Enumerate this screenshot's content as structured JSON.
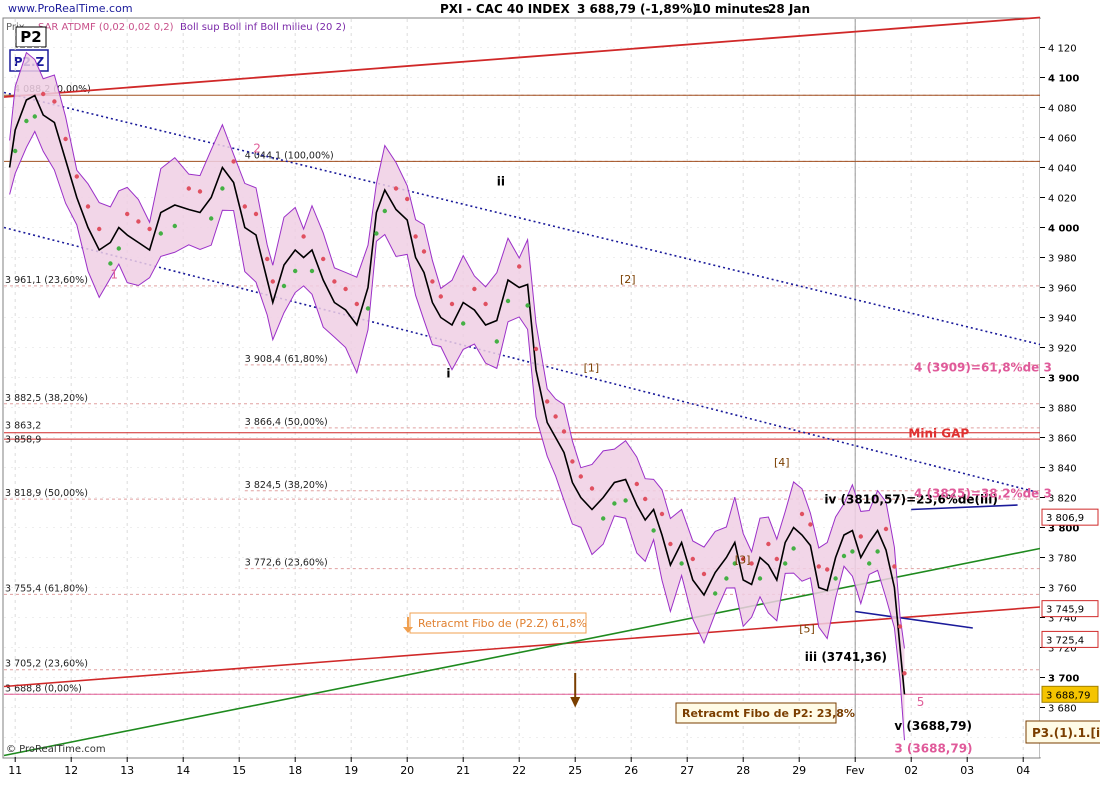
{
  "header": {
    "site": "www.ProRealTime.com",
    "title": "PXI - CAC 40 INDEX",
    "price": "3 688,79 (-1,89%)",
    "period": "10 minutes",
    "date": "28 Jan"
  },
  "indicators": {
    "price_label": "Prix",
    "sar": "SAR ATDMF (0,02 0,02 0,2)",
    "boll": "Boll sup Boll inf Boll milieu (20 2)"
  },
  "badges": {
    "p2": "P2",
    "p2z": "P2.Z"
  },
  "footer": "© ProRealTime.com",
  "colors": {
    "price": "#000000",
    "bollinger_fill": "#f0cfe4",
    "bollinger_line": "#9b30c8",
    "sar_green": "#44b044",
    "sar_red": "#e05060",
    "channel": "#1a1a9a",
    "trend_red": "#d02828",
    "trend_green": "#1e8a1e",
    "fib_line": "#e0a0a0",
    "target_pink": "#e05a9a",
    "brown": "#7a3e00"
  },
  "chart_data": {
    "type": "line",
    "title": "PXI - CAC 40 INDEX",
    "period": "10 minutes",
    "y_ticks": [
      3660,
      3680,
      3700,
      3720,
      3740,
      3760,
      3780,
      3800,
      3820,
      3840,
      3860,
      3880,
      3900,
      3920,
      3940,
      3960,
      3980,
      4000,
      4020,
      4040,
      4060,
      4080,
      4100,
      4120
    ],
    "y_tick_labels": [
      "3 660",
      "3 680",
      "3 700",
      "3 720",
      "3 740",
      "3 760",
      "3 780",
      "3 800",
      "3 820",
      "3 840",
      "3 860",
      "3 880",
      "3 900",
      "3 920",
      "3 940",
      "3 960",
      "3 980",
      "4 000",
      "4 020",
      "4 040",
      "4 060",
      "4 080",
      "4 100",
      "4 120"
    ],
    "ylim": [
      3647,
      4139
    ],
    "x_labels": [
      "11",
      "12",
      "13",
      "14",
      "15",
      "18",
      "19",
      "20",
      "21",
      "22",
      "25",
      "26",
      "27",
      "28",
      "29",
      "Fev",
      "02",
      "03",
      "04"
    ],
    "x_ticks": [
      11,
      12,
      13,
      14,
      15,
      16,
      17,
      18,
      19,
      20,
      21,
      22,
      23,
      24,
      25,
      26,
      27,
      28,
      29
    ],
    "xlim": [
      10.8,
      29.3
    ],
    "series": [
      {
        "x": [
          10.9,
          11.0,
          11.2,
          11.35,
          11.5,
          11.7,
          11.9,
          12.1,
          12.3,
          12.5,
          12.7,
          12.85,
          13.0,
          13.2,
          13.4,
          13.6,
          13.85,
          14.1,
          14.3,
          14.5,
          14.7,
          14.9,
          15.1,
          15.3,
          15.5,
          15.6,
          15.8,
          16.0,
          16.15,
          16.3,
          16.5,
          16.7,
          16.9,
          17.1,
          17.3,
          17.45,
          17.6,
          17.8,
          18.0,
          18.15,
          18.3,
          18.45,
          18.6,
          18.8,
          19.0,
          19.2,
          19.4,
          19.6,
          19.8,
          20.0,
          20.15,
          20.3,
          20.5,
          20.65,
          20.8,
          20.95,
          21.1,
          21.3,
          21.5,
          21.7,
          21.9,
          22.1,
          22.25,
          22.4,
          22.55,
          22.7,
          22.9,
          23.1,
          23.3,
          23.5,
          23.7,
          23.85,
          24.0,
          24.15,
          24.3,
          24.45,
          24.6,
          24.75,
          24.9,
          25.05,
          25.2,
          25.35,
          25.5,
          25.65,
          25.8,
          25.95,
          26.1,
          26.25,
          26.4,
          26.55,
          26.7,
          26.8,
          26.88
        ],
        "values": [
          4040,
          4065,
          4085,
          4088,
          4075,
          4070,
          4045,
          4020,
          4000,
          3985,
          3990,
          4000,
          3995,
          3990,
          3985,
          4010,
          4015,
          4012,
          4010,
          4020,
          4040,
          4030,
          4000,
          3995,
          3965,
          3950,
          3975,
          3985,
          3980,
          3985,
          3965,
          3950,
          3945,
          3935,
          3960,
          4010,
          4025,
          4012,
          4005,
          3980,
          3970,
          3950,
          3940,
          3935,
          3950,
          3945,
          3935,
          3938,
          3965,
          3960,
          3962,
          3905,
          3870,
          3860,
          3850,
          3830,
          3820,
          3812,
          3820,
          3830,
          3832,
          3815,
          3805,
          3812,
          3795,
          3775,
          3790,
          3765,
          3755,
          3770,
          3780,
          3790,
          3765,
          3762,
          3780,
          3775,
          3765,
          3790,
          3800,
          3795,
          3788,
          3760,
          3758,
          3780,
          3795,
          3798,
          3780,
          3790,
          3798,
          3785,
          3760,
          3720,
          3688.79
        ]
      }
    ],
    "fibonacci": [
      {
        "label": "3 961,1 (23,60%)",
        "value": 3961.1
      },
      {
        "label": "3 882,5 (38,20%)",
        "value": 3882.5
      },
      {
        "label": "3 818,9 (50,00%)",
        "value": 3818.9
      },
      {
        "label": "3 755,4 (61,80%)",
        "value": 3755.4
      },
      {
        "label": "3 705,2 (23,60%)",
        "value": 3705.2
      },
      {
        "label": "3 688,8 (0,00%)",
        "value": 3688.8
      },
      {
        "label": "4 044,1 (100,00%)",
        "value": 4044.1
      },
      {
        "label": "3 908,4 (61,80%)",
        "value": 3908.4
      },
      {
        "label": "3 866,4 (50,00%)",
        "value": 3866.4
      },
      {
        "label": "3 824,5 (38,20%)",
        "value": 3824.5
      },
      {
        "label": "3 772,6 (23,60%)",
        "value": 3772.6
      },
      {
        "label": "4 088,2 (0,00%)",
        "value": 4088.2
      }
    ],
    "gap_labels": [
      "3 863,2",
      "3 858,9"
    ],
    "price_tags": [
      {
        "label": "3 806,9",
        "value": 3806.9
      },
      {
        "label": "3 745,9",
        "value": 3745.9
      },
      {
        "label": "3 725,4",
        "value": 3725.4
      },
      {
        "label": "3 688,79",
        "value": 3688.79
      }
    ],
    "annotations": {
      "wave_pink": [
        "2",
        "1",
        "5"
      ],
      "wave_brown": [
        "[2]",
        "[1]",
        "[4]",
        "[3]",
        "[5]"
      ],
      "wave_black": [
        "ii",
        "i",
        "iii (3741,36)",
        "iv (3810,57)=23,6%de(iii)",
        "v (3688,79)"
      ],
      "targets": [
        "4 (3909)=61,8%de 3",
        "4 (3825)=38,2%de 3",
        "3 (3688,79)"
      ],
      "mini_gap": "Mini GAP",
      "retr_p2z": "Retracmt Fibo de (P2.Z) 61,8%",
      "retr_p2": "Retracmt Fibo de P2: 23,8%",
      "p3_box": "P3.(1).1.[i]"
    }
  }
}
